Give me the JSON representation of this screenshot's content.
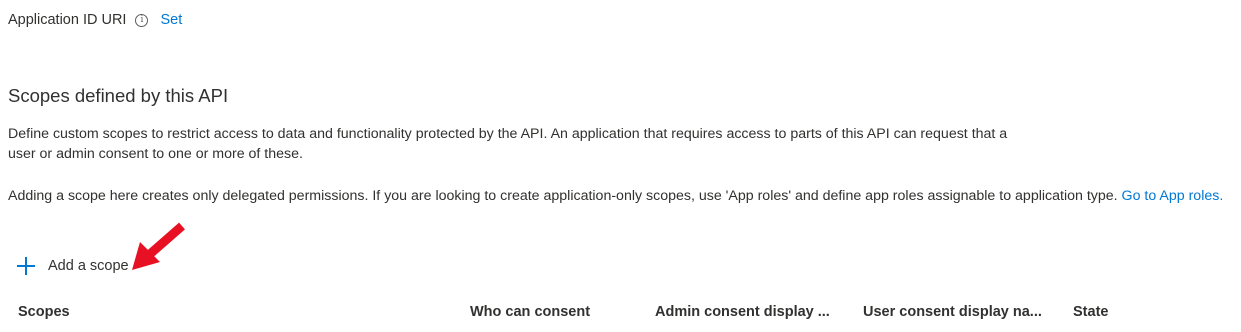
{
  "app_id_uri": {
    "label": "Application ID URI",
    "info_glyph": "i",
    "set_link": "Set"
  },
  "scopes_section": {
    "title": "Scopes defined by this API",
    "description": "Define custom scopes to restrict access to data and functionality protected by the API. An application that requires access to parts of this API can request that a user or admin consent to one or more of these.",
    "delegated_note": "Adding a scope here creates only delegated permissions. If you are looking to create application-only scopes, use 'App roles' and define app roles assignable to application type.",
    "app_roles_link": "Go to App roles.",
    "add_scope_label": "Add a scope"
  },
  "table": {
    "columns": [
      "Scopes",
      "Who can consent",
      "Admin consent display ...",
      "User consent display na...",
      "State"
    ]
  },
  "colors": {
    "accent": "#0078d4",
    "text": "#323130",
    "annotation_arrow": "#e81123"
  },
  "icons": {
    "info": "info-icon",
    "add": "plus-icon",
    "annotation": "red-arrow-icon"
  }
}
